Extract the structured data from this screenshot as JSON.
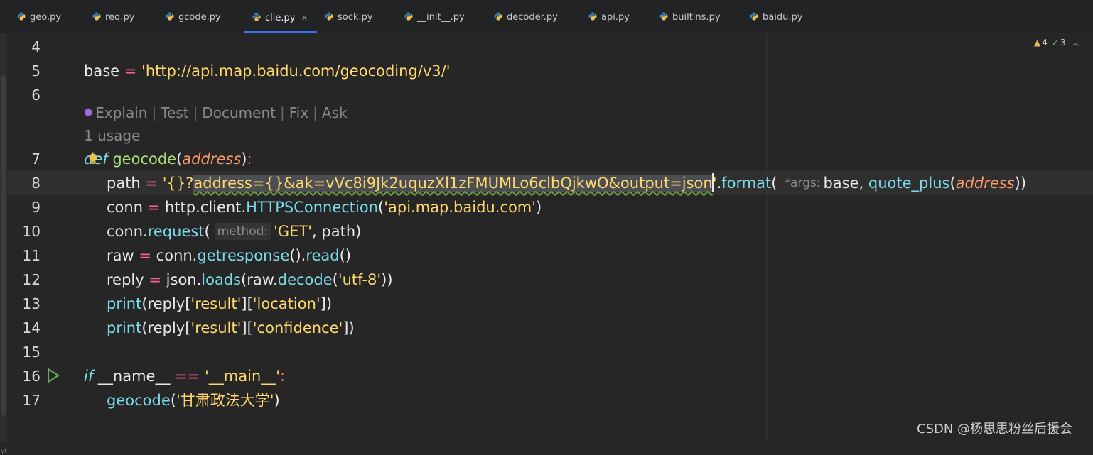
{
  "tabs": [
    {
      "label": "geo.py",
      "active": false
    },
    {
      "label": "req.py",
      "active": false
    },
    {
      "label": "gcode.py",
      "active": false
    },
    {
      "label": "clie.py",
      "active": true,
      "close": "×"
    },
    {
      "label": "sock.py",
      "active": false
    },
    {
      "label": "__init__.py",
      "active": false
    },
    {
      "label": "decoder.py",
      "active": false
    },
    {
      "label": "api.py",
      "active": false
    },
    {
      "label": "builtins.py",
      "active": false
    },
    {
      "label": "baidu.py",
      "active": false
    }
  ],
  "inspections": {
    "warnings": "4",
    "ok": "3"
  },
  "line_numbers": [
    "4",
    "5",
    "6",
    "7",
    "8",
    "9",
    "10",
    "11",
    "12",
    "13",
    "14",
    "15",
    "16",
    "17"
  ],
  "code_lens": {
    "items": [
      "Explain",
      "Test",
      "Document",
      "Fix",
      "Ask"
    ],
    "usage": "1 usage"
  },
  "code": {
    "l5": {
      "var": "base",
      "eq": "=",
      "str": "'http://api.map.baidu.com/geocoding/v3/'"
    },
    "l7": {
      "kw": "def",
      "name": "geocode",
      "p1": "(",
      "param": "address",
      "p2": ")",
      "colon": ":"
    },
    "l8": {
      "var": "path",
      "eq": "=",
      "str_a": "'{}?",
      "str_sel": "address={}&ak=vVc8i9Jk2uquzXl1zFMUMLo6clbQjkwO&output=json",
      "str_end": "'",
      "dot": ".",
      "fn": "format",
      "p1": "(",
      "hint": "*args:",
      "arg1": "base, ",
      "fn2": "quote_plus",
      "p2": "(",
      "param": "address",
      "p3": "))"
    },
    "l9": {
      "var": "conn",
      "eq": "=",
      "mod": "http.client.",
      "fn": "HTTPSConnection",
      "p1": "(",
      "str": "'api.map.baidu.com'",
      "p2": ")"
    },
    "l10": {
      "obj": "conn.",
      "fn": "request",
      "p1": "(",
      "hint": "method:",
      "str": "'GET'",
      "rest": ", path)"
    },
    "l11": {
      "var": "raw",
      "eq": "=",
      "obj": "conn.",
      "fn": "getresponse",
      "mid": "().",
      "fn2": "read",
      "end": "()"
    },
    "l12": {
      "var": "reply",
      "eq": "=",
      "obj": "json.",
      "fn": "loads",
      "p1": "(raw.",
      "fn2": "decode",
      "p2": "(",
      "str": "'utf-8'",
      "p3": "))"
    },
    "l13": {
      "fn": "print",
      "p1": "(reply[",
      "s1": "'result'",
      "mid": "][",
      "s2": "'location'",
      "end": "])"
    },
    "l14": {
      "fn": "print",
      "p1": "(reply[",
      "s1": "'result'",
      "mid": "][",
      "s2": "'confidence'",
      "end": "])"
    },
    "l16": {
      "kw": "if",
      "name": " __name__ ",
      "eq": "==",
      "str": "'__main__'",
      "colon": ":"
    },
    "l17": {
      "fn": "geocode",
      "p1": "(",
      "str": "'甘肃政法大学'",
      "p2": ")"
    }
  },
  "watermark": "CSDN @杨思思粉丝后援会",
  "left_strip_text": "yt",
  "icons": [
    "python-file-icon",
    "run-icon",
    "bulb-icon",
    "warning-icon",
    "check-icon",
    "ai-assistant-icon"
  ]
}
